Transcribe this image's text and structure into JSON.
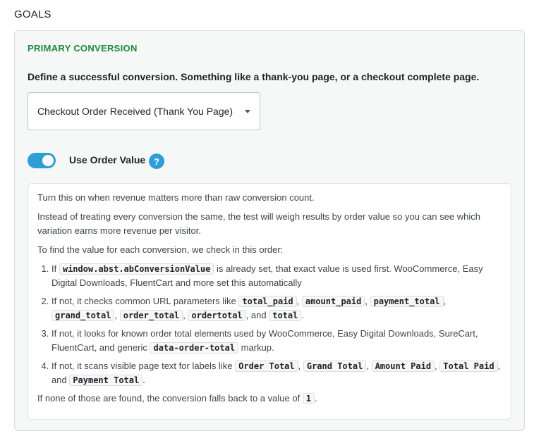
{
  "page": {
    "title": "GOALS"
  },
  "primary": {
    "section_label": "PRIMARY CONVERSION",
    "define_text": "Define a successful conversion. Something like a thank-you page, or a checkout complete page.",
    "select_value": "Checkout Order Received (Thank You Page)"
  },
  "order_value": {
    "label": "Use Order Value",
    "enabled": true,
    "toggle_color": "#2e9ed6",
    "help_icon": "question-mark-icon",
    "help_glyph": "?"
  },
  "info": {
    "p1": "Turn this on when revenue matters more than raw conversion count.",
    "p2": "Instead of treating every conversion the same, the test will weigh results by order value so you can see which variation earns more revenue per visitor.",
    "p3": "To find the value for each conversion, we check in this order:",
    "step1": {
      "pre": "If ",
      "code": "window.abst.abConversionValue",
      "post": " is already set, that exact value is used first. WooCommerce, Easy Digital Downloads, FluentCart and more set this automatically"
    },
    "step2": {
      "pre": "If not, it checks common URL parameters like ",
      "codes": [
        "total_paid",
        "amount_paid",
        "payment_total",
        "grand_total",
        "order_total",
        "ordertotal",
        "total"
      ],
      "sep": ", ",
      "and": ", and ",
      "end": "."
    },
    "step3": {
      "pre": "If not, it looks for known order total elements used by WooCommerce, Easy Digital Downloads, SureCart, FluentCart, and generic ",
      "code": "data-order-total",
      "post": " markup."
    },
    "step4": {
      "pre": "If not, it scans visible page text for labels like ",
      "codes": [
        "Order Total",
        "Grand Total",
        "Amount Paid",
        "Total Paid",
        "Payment Total"
      ],
      "sep": ", ",
      "and": ", and ",
      "end": "."
    },
    "footer": {
      "pre": "If none of those are found, the conversion falls back to a value of ",
      "code": "1",
      "post": "."
    }
  },
  "colors": {
    "accent_green": "#1e8a3b",
    "accent_blue": "#2e9ed6",
    "panel_bg": "#f6f7f7"
  }
}
